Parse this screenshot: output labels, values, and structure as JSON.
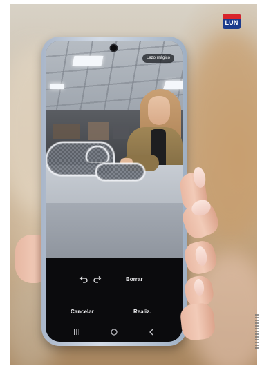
{
  "brand": {
    "badge_text": "LUN",
    "colors": {
      "top_band": "#d8232a",
      "body": "#1c3b8c"
    }
  },
  "phone": {
    "camera_overlay": {
      "chip_label": "Lazo mágico"
    },
    "toolbar": {
      "undo_icon": "undo-icon",
      "redo_icon": "redo-icon",
      "erase_label": "Borrar"
    },
    "actions": {
      "cancel_label": "Cancelar",
      "done_label": "Realiz."
    },
    "nav_bar": {
      "recents_icon": "recents-icon",
      "home_icon": "home-icon",
      "back_icon": "back-icon"
    }
  }
}
